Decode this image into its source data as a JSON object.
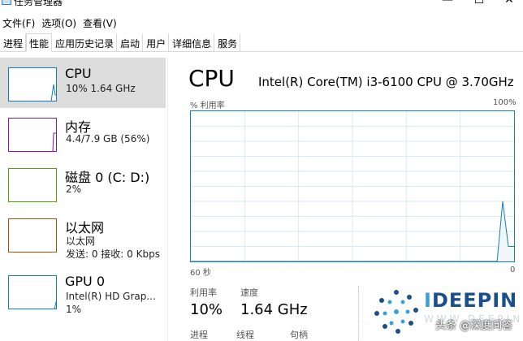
{
  "window": {
    "title": "任务管理器",
    "minimize": "—",
    "maximize": "☐",
    "close": "✕"
  },
  "menu": [
    "文件(F)",
    "选项(O)",
    "查看(V)"
  ],
  "tabs": [
    "进程",
    "性能",
    "应用历史记录",
    "启动",
    "用户",
    "详细信息",
    "服务"
  ],
  "active_tab": 1,
  "resources": [
    {
      "name": "CPU",
      "sub": "10% 1.64 GHz",
      "sub2": "",
      "color": "#117dbb",
      "selected": true
    },
    {
      "name": "内存",
      "sub": "4.4/7.9 GB (56%)",
      "sub2": "",
      "color": "#8b12ae",
      "selected": false
    },
    {
      "name": "磁盘 0 (C: D:)",
      "sub": "2%",
      "sub2": "",
      "color": "#4da60c",
      "selected": false
    },
    {
      "name": "以太网",
      "sub": "以太网",
      "sub2": "发送: 0 接收: 0 Kbps",
      "color": "#a74f01",
      "selected": false
    },
    {
      "name": "GPU 0",
      "sub": "Intel(R) HD Grap...",
      "sub2": "1%",
      "color": "#117dbb",
      "selected": false
    }
  ],
  "detail": {
    "heading": "CPU",
    "model": "Intel(R) Core(TM) i3-6100 CPU @ 3.70GHz",
    "util_label": "% 利用率",
    "util_max": "100%",
    "time_left": "60 秒",
    "time_right": "0",
    "stats": {
      "util_label": "利用率",
      "util_value": "10%",
      "speed_label": "速度",
      "speed_value": "1.64 GHz",
      "proc_label": "进程",
      "thread_label": "线程",
      "handle_label": "句柄"
    }
  },
  "cpu_history": [
    0,
    0,
    0,
    0,
    0,
    0,
    0,
    0,
    0,
    0,
    0,
    0,
    0,
    0,
    0,
    0,
    0,
    0,
    0,
    0,
    0,
    0,
    0,
    0,
    0,
    0,
    0,
    0,
    0,
    0,
    0,
    0,
    0,
    0,
    0,
    0,
    0,
    0,
    0,
    0,
    0,
    0,
    0,
    0,
    0,
    0,
    0,
    0,
    0,
    0,
    0,
    0,
    0,
    0,
    0,
    40,
    10,
    10
  ],
  "watermark": {
    "brand_pre": "I",
    "brand_rest": "DEEPIN",
    "tagline": "头条 @深度问答",
    "faint": "WWW.DEEPIN"
  }
}
